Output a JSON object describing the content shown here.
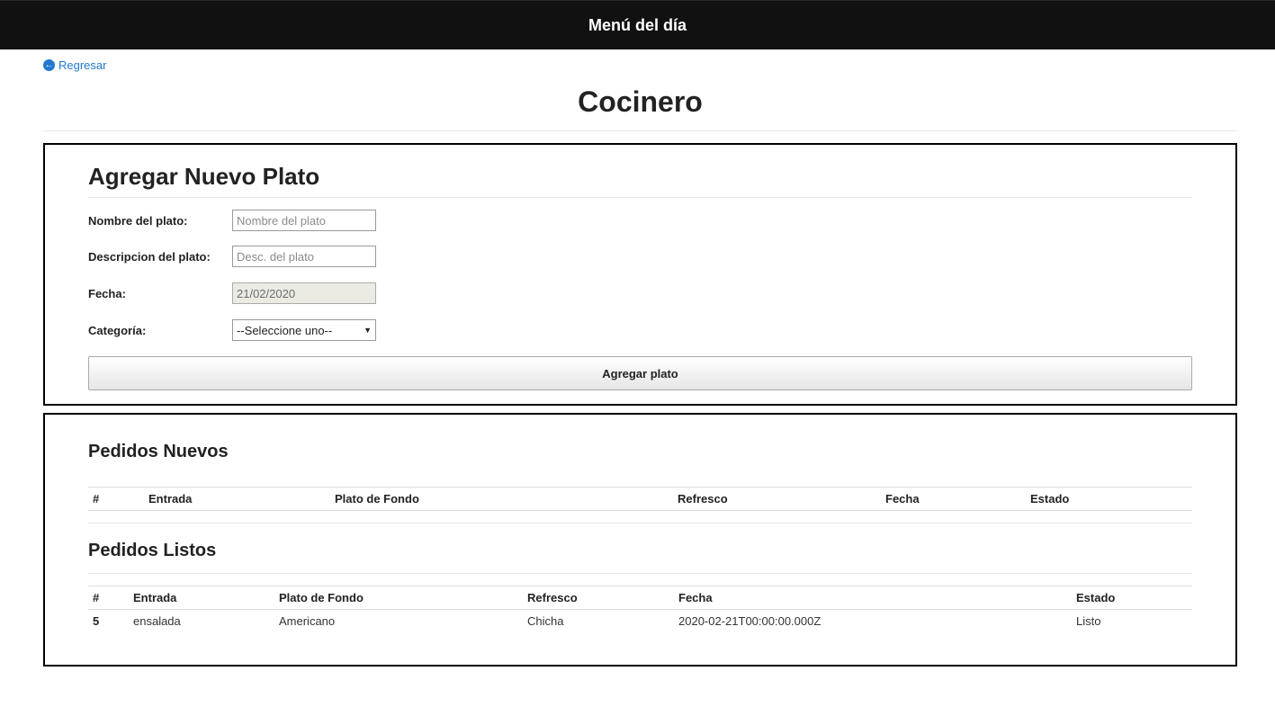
{
  "header": {
    "title": "Menú del día"
  },
  "back_link": {
    "label": "Regresar",
    "icon": "arrow-circle-left-icon"
  },
  "page": {
    "title": "Cocinero"
  },
  "form": {
    "heading": "Agregar Nuevo Plato",
    "fields": {
      "nombre": {
        "label": "Nombre del plato:",
        "placeholder": "Nombre del plato",
        "value": ""
      },
      "descripcion": {
        "label": "Descripcion del plato:",
        "placeholder": "Desc. del plato",
        "value": ""
      },
      "fecha": {
        "label": "Fecha:",
        "value": "21/02/2020"
      },
      "categoria": {
        "label": "Categoría:",
        "selected": "--Seleccione uno--"
      }
    },
    "submit_label": "Agregar plato"
  },
  "pedidos_nuevos": {
    "heading": "Pedidos Nuevos",
    "columns": [
      "#",
      "Entrada",
      "Plato de Fondo",
      "Refresco",
      "Fecha",
      "Estado"
    ],
    "rows": []
  },
  "pedidos_listos": {
    "heading": "Pedidos Listos",
    "columns": [
      "#",
      "Entrada",
      "Plato de Fondo",
      "Refresco",
      "Fecha",
      "Estado"
    ],
    "rows": [
      {
        "id": "5",
        "entrada": "ensalada",
        "plato": "Americano",
        "refresco": "Chicha",
        "fecha": "2020-02-21T00:00:00.000Z",
        "estado": "Listo"
      }
    ]
  },
  "colors": {
    "navbar": "#111111",
    "link": "#2379cf",
    "panel_border": "#000000"
  }
}
